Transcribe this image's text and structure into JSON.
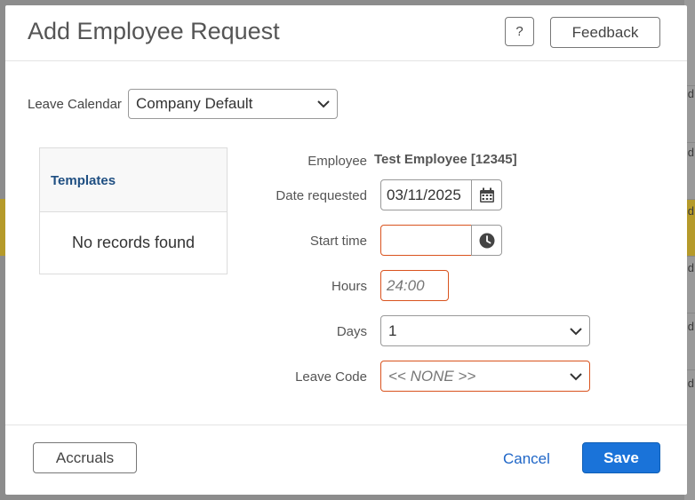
{
  "background": {
    "fragments": [
      "d",
      "d",
      "d",
      "d",
      "d",
      "d"
    ]
  },
  "dialog": {
    "title": "Add Employee Request",
    "help_label": "?",
    "feedback_label": "Feedback"
  },
  "leave_calendar": {
    "label": "Leave Calendar",
    "value": "Company Default"
  },
  "templates": {
    "header": "Templates",
    "empty_text": "No records found"
  },
  "form": {
    "employee_label": "Employee",
    "employee_value": "Test Employee [12345]",
    "date_label": "Date requested",
    "date_value": "03/11/2025",
    "start_label": "Start time",
    "start_value": "",
    "hours_label": "Hours",
    "hours_placeholder": "24:00",
    "days_label": "Days",
    "days_value": "1",
    "leave_code_label": "Leave Code",
    "leave_code_value": "<< NONE >>"
  },
  "footer": {
    "accruals_label": "Accruals",
    "cancel_label": "Cancel",
    "save_label": "Save"
  },
  "colors": {
    "primary": "#1a73d9",
    "error_border": "#d9531e",
    "link": "#1f66c7"
  }
}
